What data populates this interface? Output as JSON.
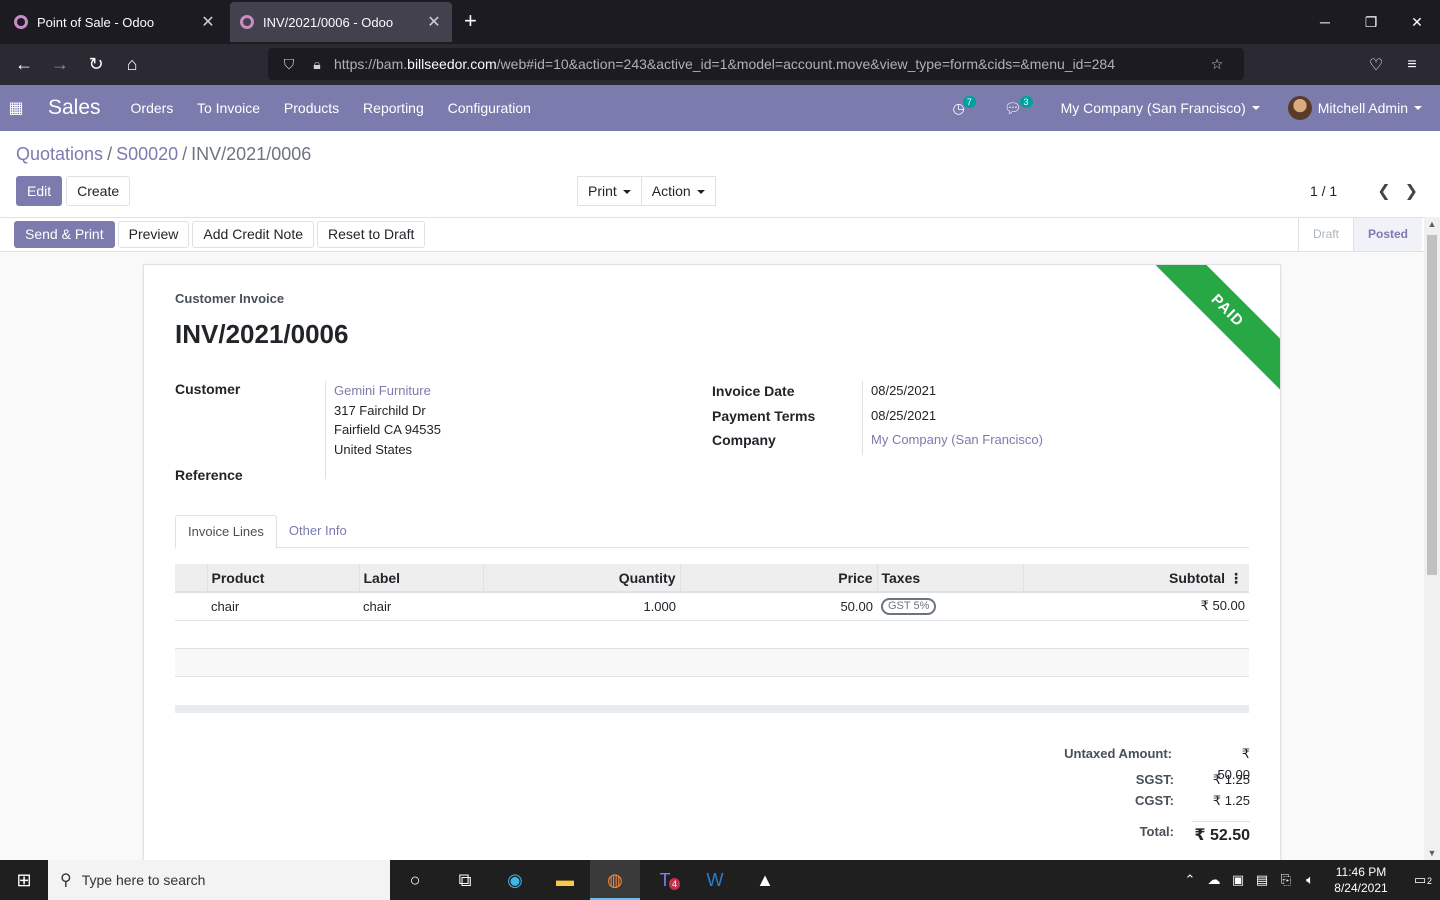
{
  "browser": {
    "tabs": [
      {
        "title": "Point of Sale - Odoo",
        "active": false
      },
      {
        "title": "INV/2021/0006 - Odoo",
        "active": true
      }
    ],
    "url_prefix": "https://bam.",
    "url_host": "billseedor.com",
    "url_rest": "/web#id=10&action=243&active_id=1&model=account.move&view_type=form&cids=&menu_id=284"
  },
  "odoo": {
    "app_name": "Sales",
    "menu": [
      "Orders",
      "To Invoice",
      "Products",
      "Reporting",
      "Configuration"
    ],
    "activity_count": "7",
    "message_count": "3",
    "company": "My Company (San Francisco)",
    "user": "Mitchell Admin",
    "accent_color": "#7c7bad"
  },
  "breadcrumb": [
    "Quotations",
    "S00020",
    "INV/2021/0006"
  ],
  "control": {
    "edit": "Edit",
    "create": "Create",
    "print": "Print",
    "action": "Action",
    "pager": "1 / 1"
  },
  "statusbar": {
    "buttons": [
      "Send & Print",
      "Preview",
      "Add Credit Note",
      "Reset to Draft"
    ],
    "stages": [
      {
        "label": "Draft",
        "active": false
      },
      {
        "label": "Posted",
        "active": true
      }
    ]
  },
  "invoice": {
    "ribbon": "PAID",
    "type_label": "Customer Invoice",
    "name": "INV/2021/0006",
    "customer_label": "Customer",
    "customer_name": "Gemini Furniture",
    "address": [
      "317 Fairchild Dr",
      "Fairfield CA 94535",
      "United States"
    ],
    "reference_label": "Reference",
    "invoice_date_label": "Invoice Date",
    "invoice_date": "08/25/2021",
    "payment_terms_label": "Payment Terms",
    "payment_terms": "08/25/2021",
    "company_label": "Company",
    "company": "My Company (San Francisco)"
  },
  "notebook": {
    "tabs": [
      "Invoice Lines",
      "Other Info"
    ],
    "active": 0
  },
  "lines": {
    "headers": [
      "Product",
      "Label",
      "Quantity",
      "Price",
      "Taxes",
      "Subtotal"
    ],
    "rows": [
      {
        "product": "chair",
        "label": "chair",
        "quantity": "1.000",
        "price": "50.00",
        "tax": "GST 5%",
        "subtotal": "₹ 50.00"
      }
    ]
  },
  "totals": {
    "untaxed_label": "Untaxed Amount:",
    "untaxed": "₹ 50.00",
    "sgst_label": "SGST:",
    "sgst": "₹ 1.25",
    "cgst_label": "CGST:",
    "cgst": "₹ 1.25",
    "total_label": "Total:",
    "total": "₹ 52.50"
  },
  "taskbar": {
    "search_placeholder": "Type here to search",
    "teams_badge": "4",
    "time": "11:46 PM",
    "date": "8/24/2021",
    "notifications": "2"
  }
}
